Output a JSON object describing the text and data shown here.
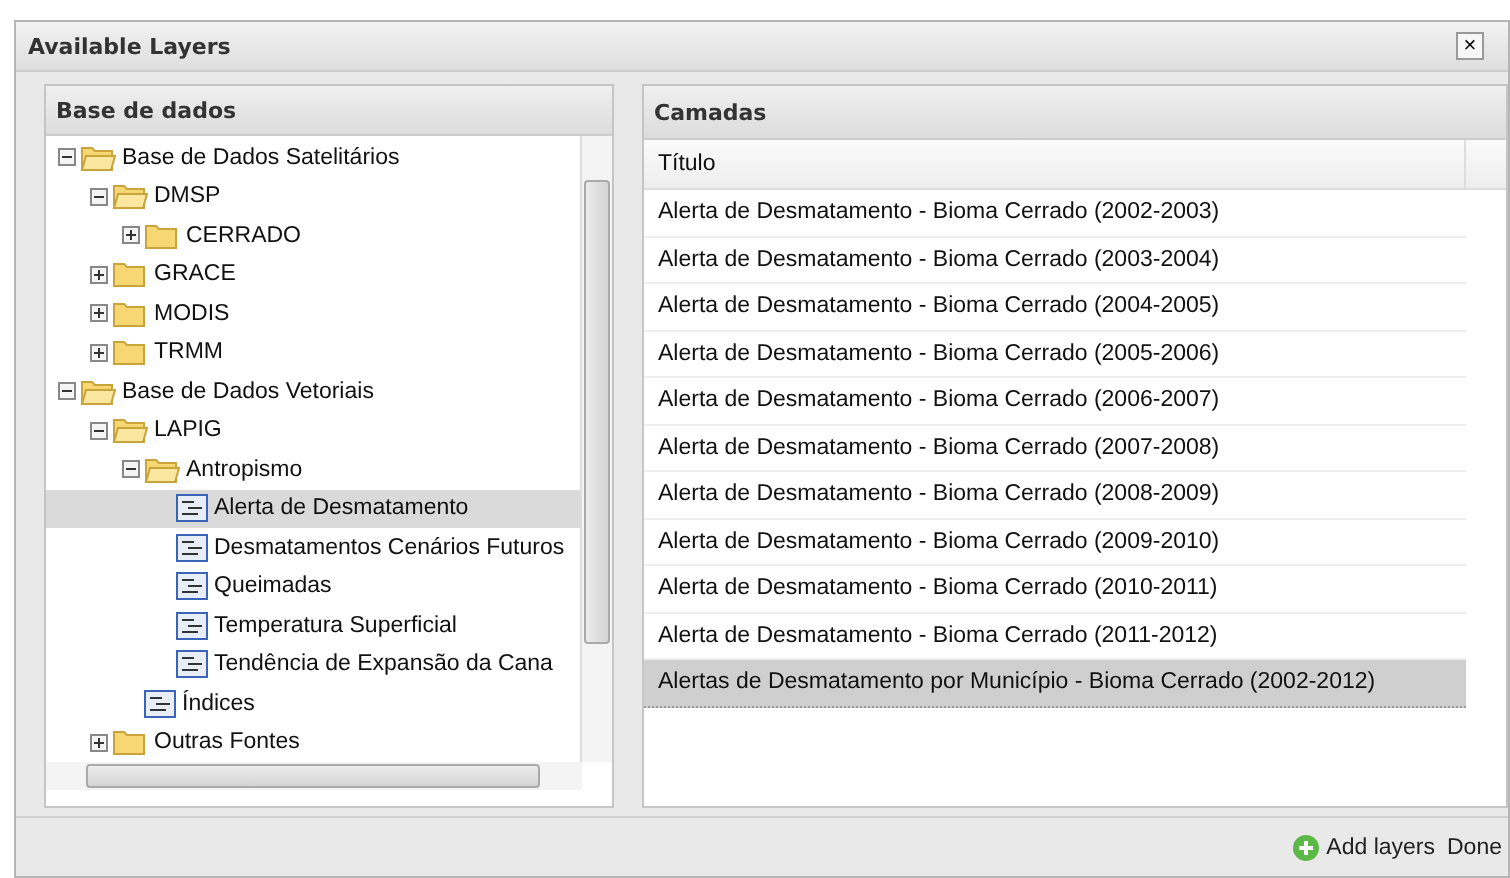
{
  "window": {
    "title": "Available Layers",
    "close": "×"
  },
  "tree_panel": {
    "title": "Base de dados",
    "items": [
      {
        "label": "Base de Dados Satelitários",
        "kind": "folder",
        "expanded": true,
        "selected": false,
        "children": [
          {
            "label": "DMSP",
            "kind": "folder",
            "expanded": true,
            "selected": false,
            "children": [
              {
                "label": "CERRADO",
                "kind": "folder",
                "expanded": false,
                "selected": false
              }
            ]
          },
          {
            "label": "GRACE",
            "kind": "folder",
            "expanded": false,
            "selected": false
          },
          {
            "label": "MODIS",
            "kind": "folder",
            "expanded": false,
            "selected": false
          },
          {
            "label": "TRMM",
            "kind": "folder",
            "expanded": false,
            "selected": false
          }
        ]
      },
      {
        "label": "Base de Dados Vetoriais",
        "kind": "folder",
        "expanded": true,
        "selected": false,
        "children": [
          {
            "label": "LAPIG",
            "kind": "folder",
            "expanded": true,
            "selected": false,
            "children": [
              {
                "label": "Antropismo",
                "kind": "folder",
                "expanded": true,
                "selected": false,
                "children": [
                  {
                    "label": "Alerta de Desmatamento",
                    "kind": "layer",
                    "selected": true
                  },
                  {
                    "label": "Desmatamentos Cenários Futuros",
                    "kind": "layer",
                    "selected": false
                  },
                  {
                    "label": "Queimadas",
                    "kind": "layer",
                    "selected": false
                  },
                  {
                    "label": "Temperatura Superficial",
                    "kind": "layer",
                    "selected": false
                  },
                  {
                    "label": "Tendência de Expansão da Cana",
                    "kind": "layer",
                    "selected": false
                  }
                ]
              },
              {
                "label": "Índices",
                "kind": "layer",
                "selected": false
              }
            ]
          },
          {
            "label": "Outras Fontes",
            "kind": "folder",
            "expanded": false,
            "selected": false
          }
        ]
      }
    ]
  },
  "layers_panel": {
    "title": "Camadas",
    "columns": [
      "Título"
    ],
    "rows": [
      {
        "title": "Alerta de Desmatamento - Bioma Cerrado (2002-2003)",
        "selected": false
      },
      {
        "title": "Alerta de Desmatamento - Bioma Cerrado (2003-2004)",
        "selected": false
      },
      {
        "title": "Alerta de Desmatamento - Bioma Cerrado (2004-2005)",
        "selected": false
      },
      {
        "title": "Alerta de Desmatamento - Bioma Cerrado (2005-2006)",
        "selected": false
      },
      {
        "title": "Alerta de Desmatamento - Bioma Cerrado (2006-2007)",
        "selected": false
      },
      {
        "title": "Alerta de Desmatamento - Bioma Cerrado (2007-2008)",
        "selected": false
      },
      {
        "title": "Alerta de Desmatamento - Bioma Cerrado (2008-2009)",
        "selected": false
      },
      {
        "title": "Alerta de Desmatamento - Bioma Cerrado (2009-2010)",
        "selected": false
      },
      {
        "title": "Alerta de Desmatamento - Bioma Cerrado (2010-2011)",
        "selected": false
      },
      {
        "title": "Alerta de Desmatamento - Bioma Cerrado (2011-2012)",
        "selected": false
      },
      {
        "title": "Alertas de Desmatamento por Município - Bioma Cerrado (2002-2012)",
        "selected": true
      }
    ]
  },
  "footer": {
    "buttons": [
      {
        "label": "Add layers",
        "kind": "add"
      },
      {
        "label": "Done",
        "kind": "plain"
      }
    ]
  }
}
